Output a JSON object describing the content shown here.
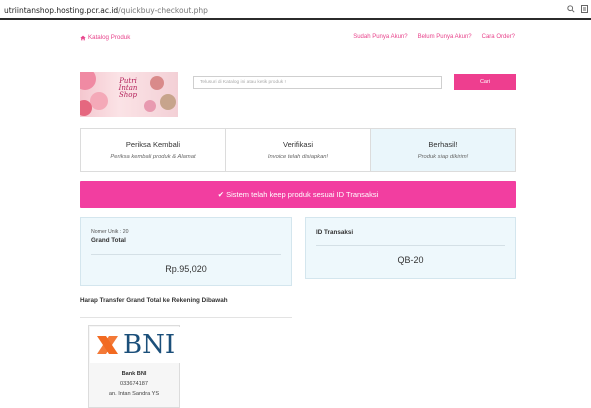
{
  "browser": {
    "url_host": "utriintanshop.hosting.pcr.ac.id",
    "url_path": "/quickbuy-checkout.php"
  },
  "nav": {
    "home_label": "Katalog Produk",
    "links": [
      "Sudah Punya Akun?",
      "Belum Punya Akun?",
      "Cara Order?"
    ]
  },
  "logo": {
    "line1": "Putri",
    "line2": "Intan",
    "line3": "Shop"
  },
  "search": {
    "placeholder": "Telusuri di Katalog ini atau ketik produk !",
    "button": "Cari"
  },
  "steps": [
    {
      "title": "Periksa Kembali",
      "desc": "Periksa kembali produk & Alamat"
    },
    {
      "title": "Verifikasi",
      "desc": "Invoice telah disiapkan!"
    },
    {
      "title": "Berhasil!",
      "desc": "Produk siap dikirim!"
    }
  ],
  "banner": "✔ Sistem telah keep produk sesuai ID Transaksi",
  "summary": {
    "unique_label": "Nomer Unik : 20",
    "total_label": "Grand Total",
    "total_value": "Rp.95,020",
    "trx_label": "ID Transaksi",
    "trx_value": "QB-20"
  },
  "transfer_note": "Harap Transfer Grand Total ke Rekening Dibawah",
  "bank": {
    "logo_text": "BNI",
    "name": "Bank BNI",
    "account": "033674187",
    "holder": "an. Intan Sandra YS"
  },
  "colors": {
    "accent": "#ee3e8f",
    "banner": "#f23ea0",
    "info_bg": "#eef8fc",
    "bni_blue": "#1b4f7a",
    "bni_orange": "#f26a21"
  }
}
